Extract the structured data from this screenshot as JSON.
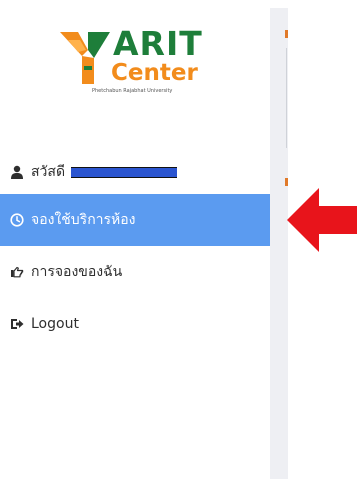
{
  "logo": {
    "title": "ARIT",
    "subtitle": "Center",
    "university": "Phetchabun Rajabhat University"
  },
  "sidebar": {
    "greeting": "สวัสดี",
    "items": [
      {
        "label": "จองใช้บริการห้อง",
        "icon": "clock-icon",
        "active": true
      },
      {
        "label": "การจองของฉัน",
        "icon": "hand-point-icon",
        "active": false
      },
      {
        "label": "Logout",
        "icon": "sign-out-icon",
        "active": false
      }
    ]
  },
  "colors": {
    "active_bg": "#5b9bf0",
    "arrow": "#e8141b",
    "logo_green": "#1e7e3a",
    "logo_orange": "#f28c1c"
  }
}
